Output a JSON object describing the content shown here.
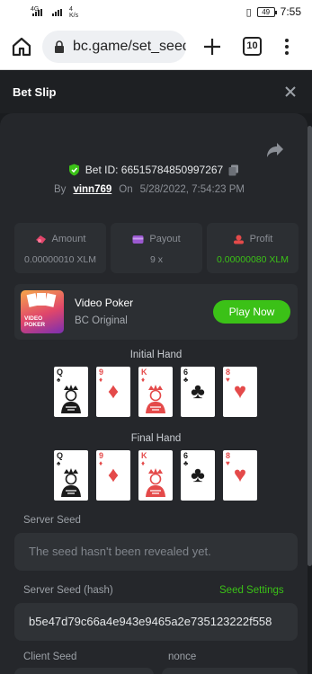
{
  "status": {
    "network1": "4G",
    "network2": "4G",
    "speed": "4",
    "speed_unit": "K/s",
    "battery": "49",
    "time": "7:55"
  },
  "browser": {
    "url": "bc.game/set_seed",
    "tab_count": "10"
  },
  "header": {
    "title": "Bet Slip"
  },
  "bet": {
    "id_label": "Bet ID: 66515784850997267",
    "by_label": "By",
    "user": "vinn769",
    "on_label": "On",
    "datetime": "5/28/2022, 7:54:23 PM"
  },
  "stats": [
    {
      "label": "Amount",
      "value": "0.00000010 XLM",
      "icon": "amount-icon"
    },
    {
      "label": "Payout",
      "value": "9 x",
      "icon": "payout-icon"
    },
    {
      "label": "Profit",
      "value": "0.00000080 XLM",
      "icon": "profit-icon"
    }
  ],
  "game": {
    "name": "Video Poker",
    "subtitle": "BC Original",
    "play_label": "Play Now",
    "thumb_text": "VIDEO POKER"
  },
  "initial_hand": {
    "title": "Initial Hand",
    "cards": [
      {
        "rank": "Q",
        "suit": "♠",
        "color": "black",
        "face": true
      },
      {
        "rank": "9",
        "suit": "♦",
        "color": "red",
        "face": false
      },
      {
        "rank": "K",
        "suit": "♦",
        "color": "red",
        "face": true
      },
      {
        "rank": "6",
        "suit": "♣",
        "color": "black",
        "face": false
      },
      {
        "rank": "8",
        "suit": "♥",
        "color": "red",
        "face": false
      }
    ]
  },
  "final_hand": {
    "title": "Final Hand",
    "cards": [
      {
        "rank": "Q",
        "suit": "♠",
        "color": "black",
        "face": true
      },
      {
        "rank": "9",
        "suit": "♦",
        "color": "red",
        "face": false
      },
      {
        "rank": "K",
        "suit": "♦",
        "color": "red",
        "face": true
      },
      {
        "rank": "6",
        "suit": "♣",
        "color": "black",
        "face": false
      },
      {
        "rank": "8",
        "suit": "♥",
        "color": "red",
        "face": false
      }
    ]
  },
  "server_seed": {
    "label": "Server Seed",
    "value": "The seed hasn't been revealed yet."
  },
  "server_seed_hash": {
    "label": "Server Seed (hash)",
    "settings_label": "Seed Settings",
    "value": "b5e47d79c66a4e943e9465a2e735123222f558"
  },
  "client_seed": {
    "label": "Client Seed"
  },
  "nonce": {
    "label": "nonce"
  },
  "colors": {
    "accent_green": "#3bc117",
    "background": "#1a1c1f",
    "panel": "#25272b"
  }
}
